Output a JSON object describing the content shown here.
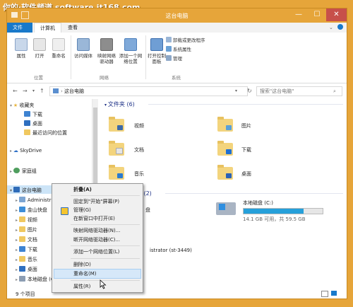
{
  "watermark": "你的·软件频道 software.it168.com",
  "window": {
    "title": "这台电脑",
    "controls": [
      "—",
      "☐",
      "✕"
    ]
  },
  "ribbon": {
    "tabs": [
      "文件",
      "计算机",
      "查看"
    ],
    "location": {
      "buttons": [
        "属性",
        "打开",
        "重命名"
      ],
      "label": "位置"
    },
    "network": {
      "buttons": [
        "访问媒体",
        "映射网络驱动器",
        "添加一个网络位置"
      ],
      "label": "网络"
    },
    "system": {
      "open_control_panel": "打开控制面板",
      "items": [
        "卸载或更改程序",
        "系统属性",
        "管理"
      ],
      "label": "系统"
    }
  },
  "address": {
    "path": "这台电脑",
    "search_placeholder": "搜索\"这台电脑\""
  },
  "nav": {
    "favorites": "收藏夹",
    "favorites_items": [
      "下载",
      "桌面",
      "最近访问的位置"
    ],
    "skydrive": "SkyDrive",
    "homegroup": "家庭组",
    "this_pc": "这台电脑",
    "pc_items": [
      "Administra",
      "金山快盘",
      "视频",
      "图片",
      "文档",
      "下载",
      "音乐",
      "桌面",
      "本地磁盘 (C"
    ]
  },
  "content": {
    "folders_header": "文件夹 (6)",
    "folders": [
      "视频",
      "图片",
      "文档",
      "下载",
      "音乐",
      "桌面"
    ],
    "devices_header": "设备和驱动器 (2)",
    "drive_name": "本地磁盘 (C:)",
    "drive_space": "14.1 GB 可用，共 59.5 GB",
    "drive_used_fraction": 0.76,
    "partial_device_label": "盘",
    "net_header_partial": "st",
    "net_item_partial": "istrator (st-3449)"
  },
  "status": {
    "count": "9 个项目"
  },
  "context_menu": {
    "items": [
      "折叠(A)",
      "固定到\"开始\"屏幕(P)",
      "管理(G)",
      "在新窗口中打开(E)",
      "映射网络驱动器(N)...",
      "断开网络驱动器(C)...",
      "添加一个网络位置(L)",
      "删除(D)",
      "重命名(M)",
      "属性(R)"
    ],
    "highlighted": "重命名(M)"
  },
  "colors": {
    "accent": "#1979ca",
    "titlebar": "#e6a53a",
    "section": "#1e3287",
    "highlight": "#d6e8f9"
  }
}
